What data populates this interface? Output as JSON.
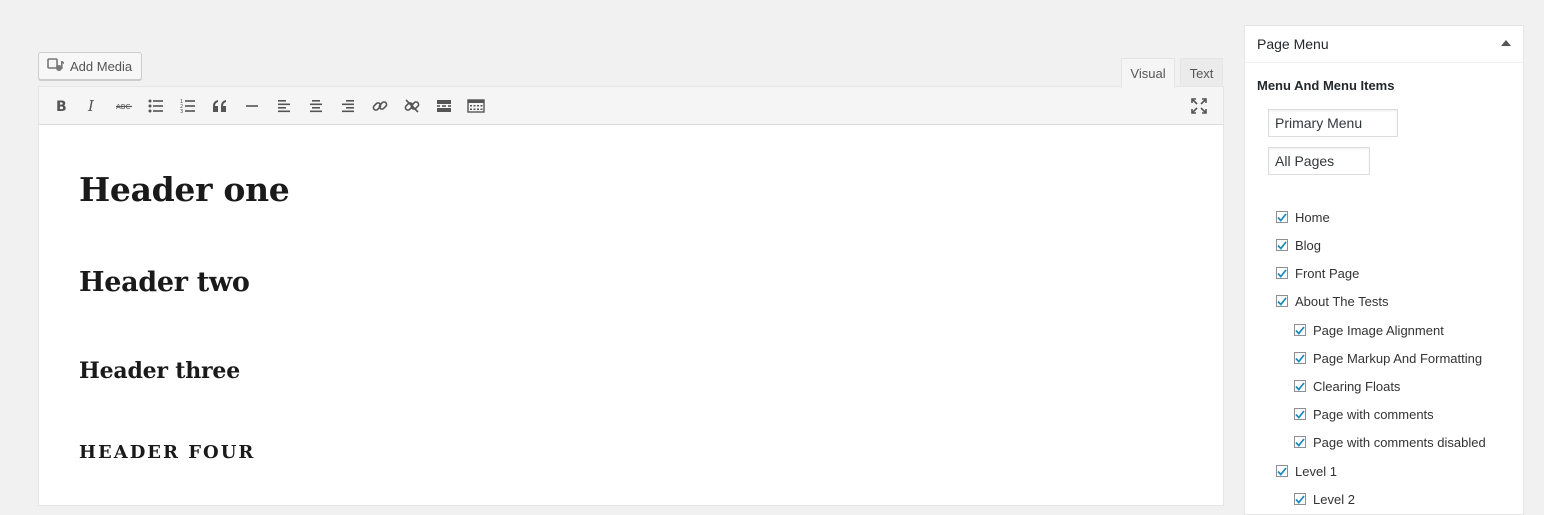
{
  "editor": {
    "add_media_label": "Add Media",
    "tabs": [
      {
        "label": "Visual",
        "active": true
      },
      {
        "label": "Text",
        "active": false
      }
    ],
    "toolbar_icons": [
      "bold-icon",
      "italic-icon",
      "strikethrough-icon",
      "bulleted-list-icon",
      "numbered-list-icon",
      "blockquote-icon",
      "horizontal-line-icon",
      "align-left-icon",
      "align-center-icon",
      "align-right-icon",
      "insert-link-icon",
      "remove-link-icon",
      "read-more-icon",
      "toolbar-toggle-icon"
    ],
    "content": {
      "h1": "Header one",
      "h2": "Header two",
      "h3": "Header three",
      "h4": "HEADER FOUR"
    }
  },
  "sidebar": {
    "panel_title": "Page Menu",
    "section_title": "Menu And Menu Items",
    "menu_select": "Primary Menu",
    "pages_select": "All Pages",
    "items": [
      {
        "label": "Home",
        "checked": true,
        "level": 0
      },
      {
        "label": "Blog",
        "checked": true,
        "level": 0
      },
      {
        "label": "Front Page",
        "checked": true,
        "level": 0
      },
      {
        "label": "About The Tests",
        "checked": true,
        "level": 0
      },
      {
        "label": "Page Image Alignment",
        "checked": true,
        "level": 1
      },
      {
        "label": "Page Markup And Formatting",
        "checked": true,
        "level": 1
      },
      {
        "label": "Clearing Floats",
        "checked": true,
        "level": 1
      },
      {
        "label": "Page with comments",
        "checked": true,
        "level": 1
      },
      {
        "label": "Page with comments disabled",
        "checked": true,
        "level": 1
      },
      {
        "label": "Level 1",
        "checked": true,
        "level": 0
      },
      {
        "label": "Level 2",
        "checked": true,
        "level": 1
      }
    ]
  },
  "colors": {
    "background": "#f1f1f1",
    "checkmark": "#1e8cbe",
    "text": "#23282d"
  }
}
